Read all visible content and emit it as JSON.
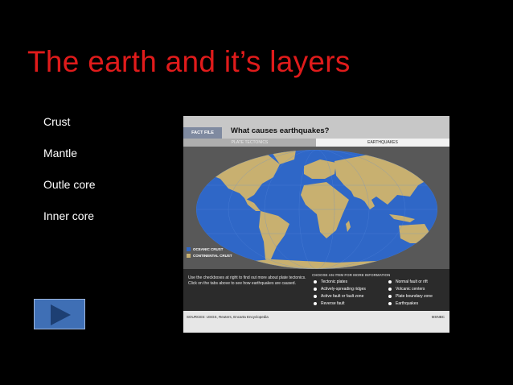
{
  "slide": {
    "title": "The earth and it’s layers",
    "bullets": [
      "Crust",
      "Mantle",
      "Outle core",
      "Inner core"
    ],
    "play_icon": "play-icon"
  },
  "figure": {
    "fact_tab": "FACT FILE",
    "heading": "What causes earthquakes?",
    "tabs": [
      "PLATE TECTONICS",
      "EARTHQUAKES"
    ],
    "legend": [
      {
        "label": "OCEANIC CRUST",
        "color": "#2f67c7"
      },
      {
        "label": "CONTINENTAL CRUST",
        "color": "#c8b070"
      }
    ],
    "description": "Use the checkboxes at right to find out more about plate tectonics. Click on the tabs above to see how earthquakes are caused.",
    "choose_label": "CHOOSE AN ITEM FOR MORE INFORMATION",
    "options_left": [
      "Tectonic plates",
      "Actively-spreading ridges",
      "Active fault or fault zone",
      "Reverse fault"
    ],
    "options_right": [
      "Normal fault or rift",
      "Volcanic centers",
      "Plate boundary zone",
      "Earthquakes"
    ],
    "sources": "SOURCES: USGS, Reuters, Encarta Encyclopedia",
    "credit": "MSNBC"
  }
}
